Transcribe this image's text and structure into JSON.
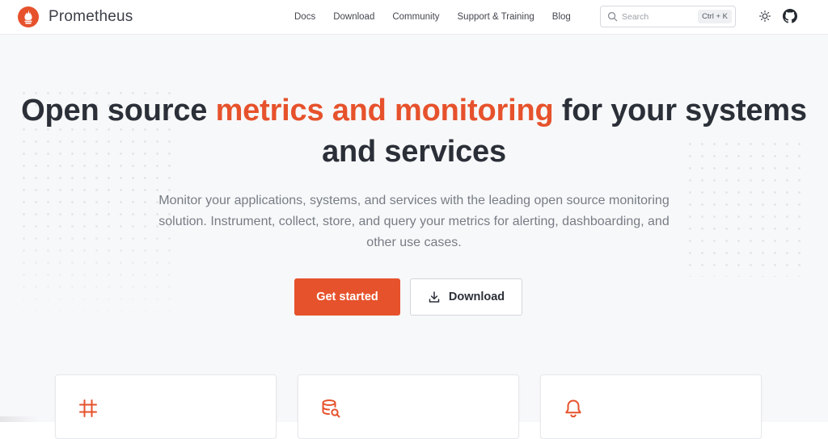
{
  "brand": {
    "name": "Prometheus",
    "accent_color": "#e6522c",
    "logo_icon": "prometheus-flame-icon"
  },
  "nav": {
    "items": [
      {
        "label": "Docs"
      },
      {
        "label": "Download"
      },
      {
        "label": "Community"
      },
      {
        "label": "Support & Training"
      },
      {
        "label": "Blog"
      }
    ]
  },
  "search": {
    "placeholder": "Search",
    "shortcut": "Ctrl + K",
    "icon": "search-icon"
  },
  "header_icons": {
    "theme": "sun-icon",
    "github": "github-icon"
  },
  "hero": {
    "headline_part1": "Open source ",
    "headline_accent": "metrics and monitoring",
    "headline_part2": " for your systems and services",
    "subtitle": "Monitor your applications, systems, and services with the leading open source monitoring solution. Instrument, collect, store, and query your metrics for alerting, dashboarding, and other use cases.",
    "primary_button": "Get started",
    "secondary_button": "Download",
    "secondary_icon": "download-icon"
  },
  "features": [
    {
      "icon": "grid-hash-icon"
    },
    {
      "icon": "database-search-icon"
    },
    {
      "icon": "bell-icon"
    }
  ]
}
